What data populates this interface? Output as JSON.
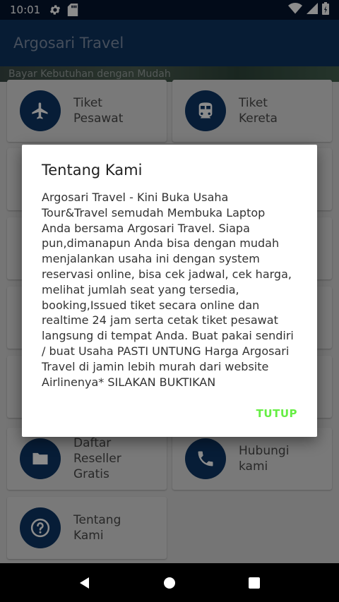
{
  "status_bar": {
    "time": "10:01",
    "icons": [
      "gear-icon",
      "sd-card-icon",
      "wifi-icon",
      "signal-icon",
      "battery-icon"
    ]
  },
  "app_bar": {
    "title": "Argosari Travel"
  },
  "banner": {
    "text": "Bayar Kebutuhan dengan Mudah"
  },
  "menu": {
    "items": [
      {
        "line1": "Tiket",
        "line2": "Pesawat",
        "icon": "airplane-icon"
      },
      {
        "line1": "Tiket",
        "line2": "Kereta",
        "icon": "train-icon"
      },
      {
        "line1": "Daftar Reseller",
        "line2": "Gratis",
        "icon": "folder-icon"
      },
      {
        "line1": "Hubungi",
        "line2": "kami",
        "icon": "phone-icon"
      },
      {
        "line1": "Tentang",
        "line2": "Kami",
        "icon": "help-icon"
      }
    ]
  },
  "dialog": {
    "title": "Tentang Kami",
    "body": "Argosari Travel - Kini Buka Usaha Tour&Travel semudah Membuka Laptop Anda bersama Argosari Travel. Siapa pun,dimanapun Anda bisa dengan mudah menjalankan usaha ini dengan system reservasi online, bisa cek jadwal, cek harga, melihat jumlah seat yang tersedia, booking,Issued tiket secara online dan realtime 24 jam serta cetak tiket pesawat langsung di tempat Anda. Buat pakai sendiri / buat Usaha PASTI UNTUNG Harga Argosari Travel di jamin lebih murah dari website Airlinenya*  SILAKAN BUKTIKAN",
    "close_label": "TUTUP"
  },
  "colors": {
    "primary": "#0d3360",
    "icon_circle": "#0e3564",
    "accent": "#66ee44"
  }
}
